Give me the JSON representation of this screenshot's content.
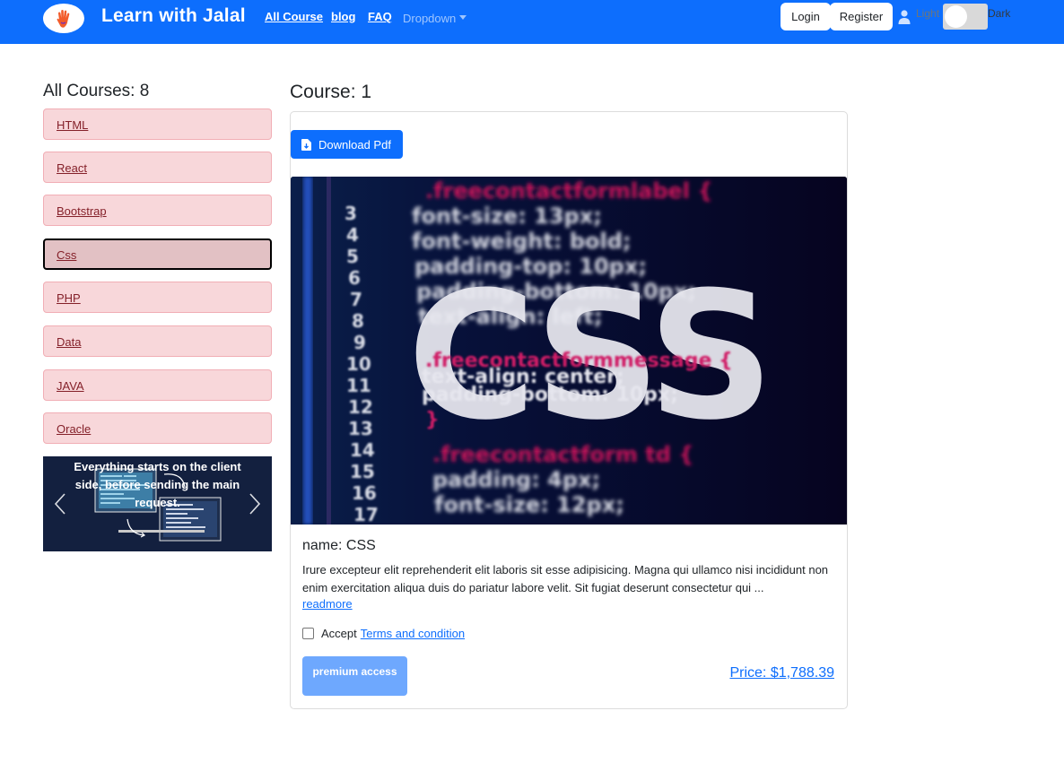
{
  "navbar": {
    "brand": "Learn with Jalal",
    "links": [
      "All Course",
      "blog",
      "FAQ"
    ],
    "dropdown_label": "Dropdown",
    "login_label": "Login",
    "register_label": "Register",
    "theme_light_label": "Light",
    "theme_dark_label": "Dark",
    "theme_mode": "light"
  },
  "sidebar": {
    "title": "All Courses: 8",
    "courses": [
      {
        "label": "HTML",
        "active": false
      },
      {
        "label": "React",
        "active": false
      },
      {
        "label": "Bootstrap",
        "active": false
      },
      {
        "label": "Css",
        "active": true
      },
      {
        "label": "PHP",
        "active": false
      },
      {
        "label": "Data",
        "active": false
      },
      {
        "label": "JAVA",
        "active": false
      },
      {
        "label": "Oracle",
        "active": false
      }
    ],
    "carousel": {
      "caption": "Everything starts on the client side, before sending the main request."
    }
  },
  "main": {
    "title": "Course: 1",
    "download_label": "Download Pdf",
    "image_code": {
      "lines": [
        ".freecontactformlabel {",
        "font-size: 13px;",
        "font-weight: bold;",
        "padding-top: 10px;",
        "padding-bottom: 10px;",
        "text-align: left;"
      ],
      "word": "CSS",
      "lower_lines": [
        ".freecontactformmessage {",
        "text-align: center;",
        "padding-bottom: 10px;",
        "}",
        ".freecontactform td {",
        "padding: 4px;",
        "font-size: 12px;"
      ],
      "gutter_numbers": [
        "3",
        "4",
        "5",
        "6",
        "7",
        "8",
        "9",
        "10",
        "11",
        "12",
        "13",
        "14",
        "15",
        "16",
        "17"
      ]
    },
    "course_name": "name: CSS",
    "description": "Irure excepteur elit reprehenderit elit laboris sit esse adipisicing. Magna qui ullamco nisi incididunt non enim exercitation aliqua duis do pariatur labore velit. Sit fugiat deserunt consectetur qui ...",
    "readmore_label": "readmore",
    "accept_label": "Accept",
    "terms_label": "Terms and condition",
    "premium_label": "premium access",
    "price_label": "Price: $1,788.39"
  },
  "colors": {
    "primary": "#0d6efd",
    "course_item_bg": "#f8d7da",
    "course_item_text": "#842029",
    "premium_btn": "#6ea8fe"
  }
}
